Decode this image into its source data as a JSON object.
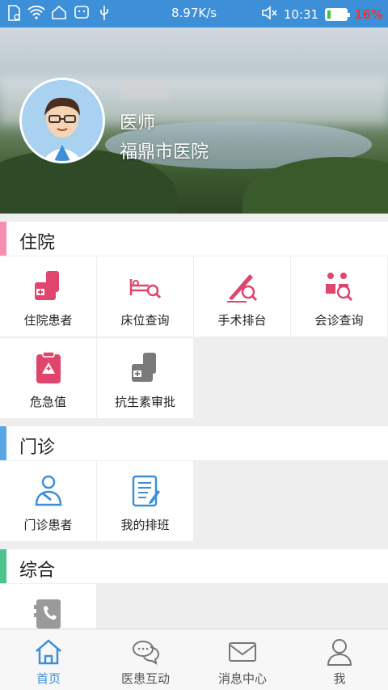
{
  "status_bar": {
    "speed": "8.97K/s",
    "time": "10:31",
    "battery_percent": "16%",
    "battery_level": 0.16
  },
  "profile": {
    "role": "医师",
    "hospital": "福鼎市医院"
  },
  "sections": {
    "inpatient": {
      "title": "住院",
      "accent_color": "#f48fb1",
      "items": [
        "住院患者",
        "床位查询",
        "手术排台",
        "会诊查询",
        "危急值",
        "抗生素审批"
      ]
    },
    "outpatient": {
      "title": "门诊",
      "accent_color": "#5aa5e6",
      "items": [
        "门诊患者",
        "我的排班"
      ]
    },
    "general": {
      "title": "综合",
      "accent_color": "#4cc38a",
      "items": [
        ""
      ]
    }
  },
  "icons": {
    "inpatient": [
      "inpatient-icon",
      "bed-search-icon",
      "surgery-icon",
      "consultation-icon",
      "critical-value-icon",
      "antibiotic-icon"
    ],
    "outpatient": [
      "outpatient-icon",
      "schedule-icon"
    ],
    "general": [
      "phonebook-icon"
    ]
  },
  "colors": {
    "primary": "#3d8fd8",
    "icon_pink": "#e0456d",
    "icon_gray": "#7a7a7a",
    "icon_blue": "#3d8fd8"
  },
  "bottom_nav": {
    "items": [
      "首页",
      "医患互动",
      "消息中心",
      "我"
    ],
    "active_index": 0
  }
}
